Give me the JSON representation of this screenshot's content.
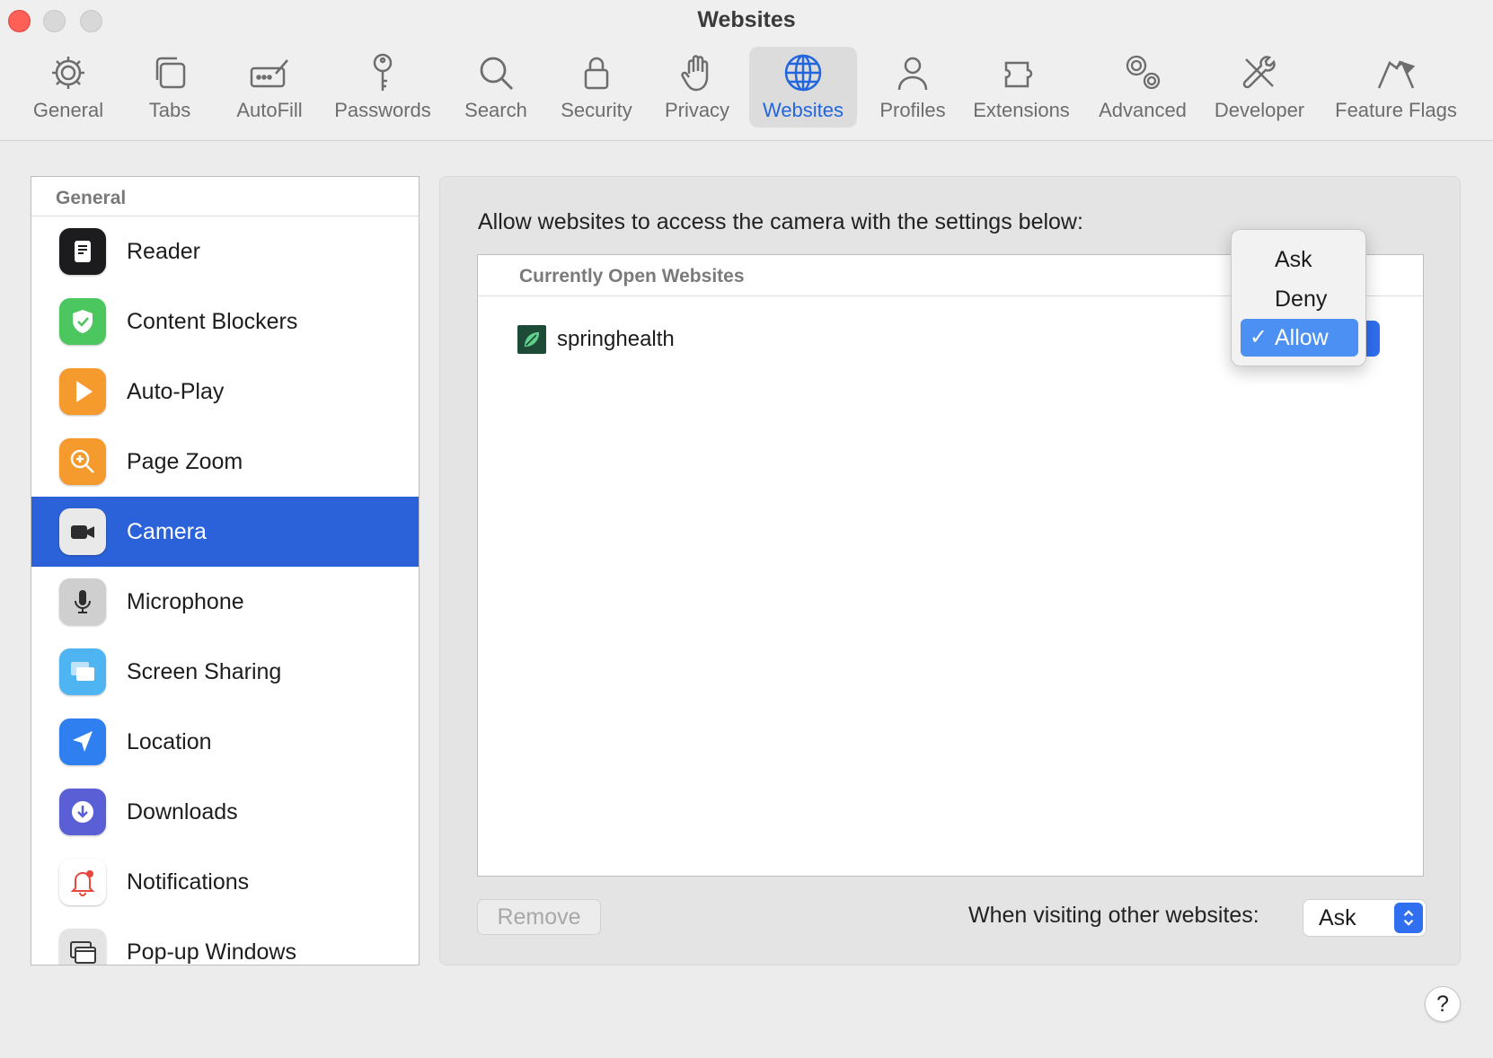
{
  "window": {
    "title": "Websites"
  },
  "toolbar": {
    "items": [
      {
        "label": "General",
        "icon": "gear-icon"
      },
      {
        "label": "Tabs",
        "icon": "tabs-icon"
      },
      {
        "label": "AutoFill",
        "icon": "autofill-icon"
      },
      {
        "label": "Passwords",
        "icon": "key-icon"
      },
      {
        "label": "Search",
        "icon": "search-icon"
      },
      {
        "label": "Security",
        "icon": "lock-icon"
      },
      {
        "label": "Privacy",
        "icon": "hand-icon"
      },
      {
        "label": "Websites",
        "icon": "globe-icon",
        "active": true
      },
      {
        "label": "Profiles",
        "icon": "person-icon"
      },
      {
        "label": "Extensions",
        "icon": "puzzle-icon"
      },
      {
        "label": "Advanced",
        "icon": "gears-icon"
      },
      {
        "label": "Developer",
        "icon": "tools-icon"
      },
      {
        "label": "Feature Flags",
        "icon": "flags-icon"
      }
    ]
  },
  "sidebar": {
    "header": "General",
    "items": [
      {
        "label": "Reader",
        "icon": "reader-icon"
      },
      {
        "label": "Content Blockers",
        "icon": "shield-icon"
      },
      {
        "label": "Auto-Play",
        "icon": "play-icon"
      },
      {
        "label": "Page Zoom",
        "icon": "zoom-icon"
      },
      {
        "label": "Camera",
        "icon": "camera-icon",
        "selected": true
      },
      {
        "label": "Microphone",
        "icon": "microphone-icon"
      },
      {
        "label": "Screen Sharing",
        "icon": "screen-sharing-icon"
      },
      {
        "label": "Location",
        "icon": "location-icon"
      },
      {
        "label": "Downloads",
        "icon": "download-icon"
      },
      {
        "label": "Notifications",
        "icon": "bell-icon"
      },
      {
        "label": "Pop-up Windows",
        "icon": "popup-window-icon"
      }
    ]
  },
  "panel": {
    "heading": "Allow websites to access the camera with the settings below:",
    "open_sites_header": "Currently Open Websites",
    "sites": [
      {
        "name": "springhealth",
        "setting": "Allow"
      }
    ],
    "menu": {
      "options": [
        "Ask",
        "Deny",
        "Allow"
      ],
      "selected": "Allow",
      "check_glyph": "✓"
    },
    "remove_label": "Remove",
    "other_label": "When visiting other websites:",
    "other_value": "Ask"
  },
  "help": {
    "label": "?"
  },
  "colors": {
    "accent": "#2b62d9",
    "active_toolbar": "#2266dd",
    "menu_highlight": "#4d90f4",
    "close_button": "#fe5f57"
  }
}
